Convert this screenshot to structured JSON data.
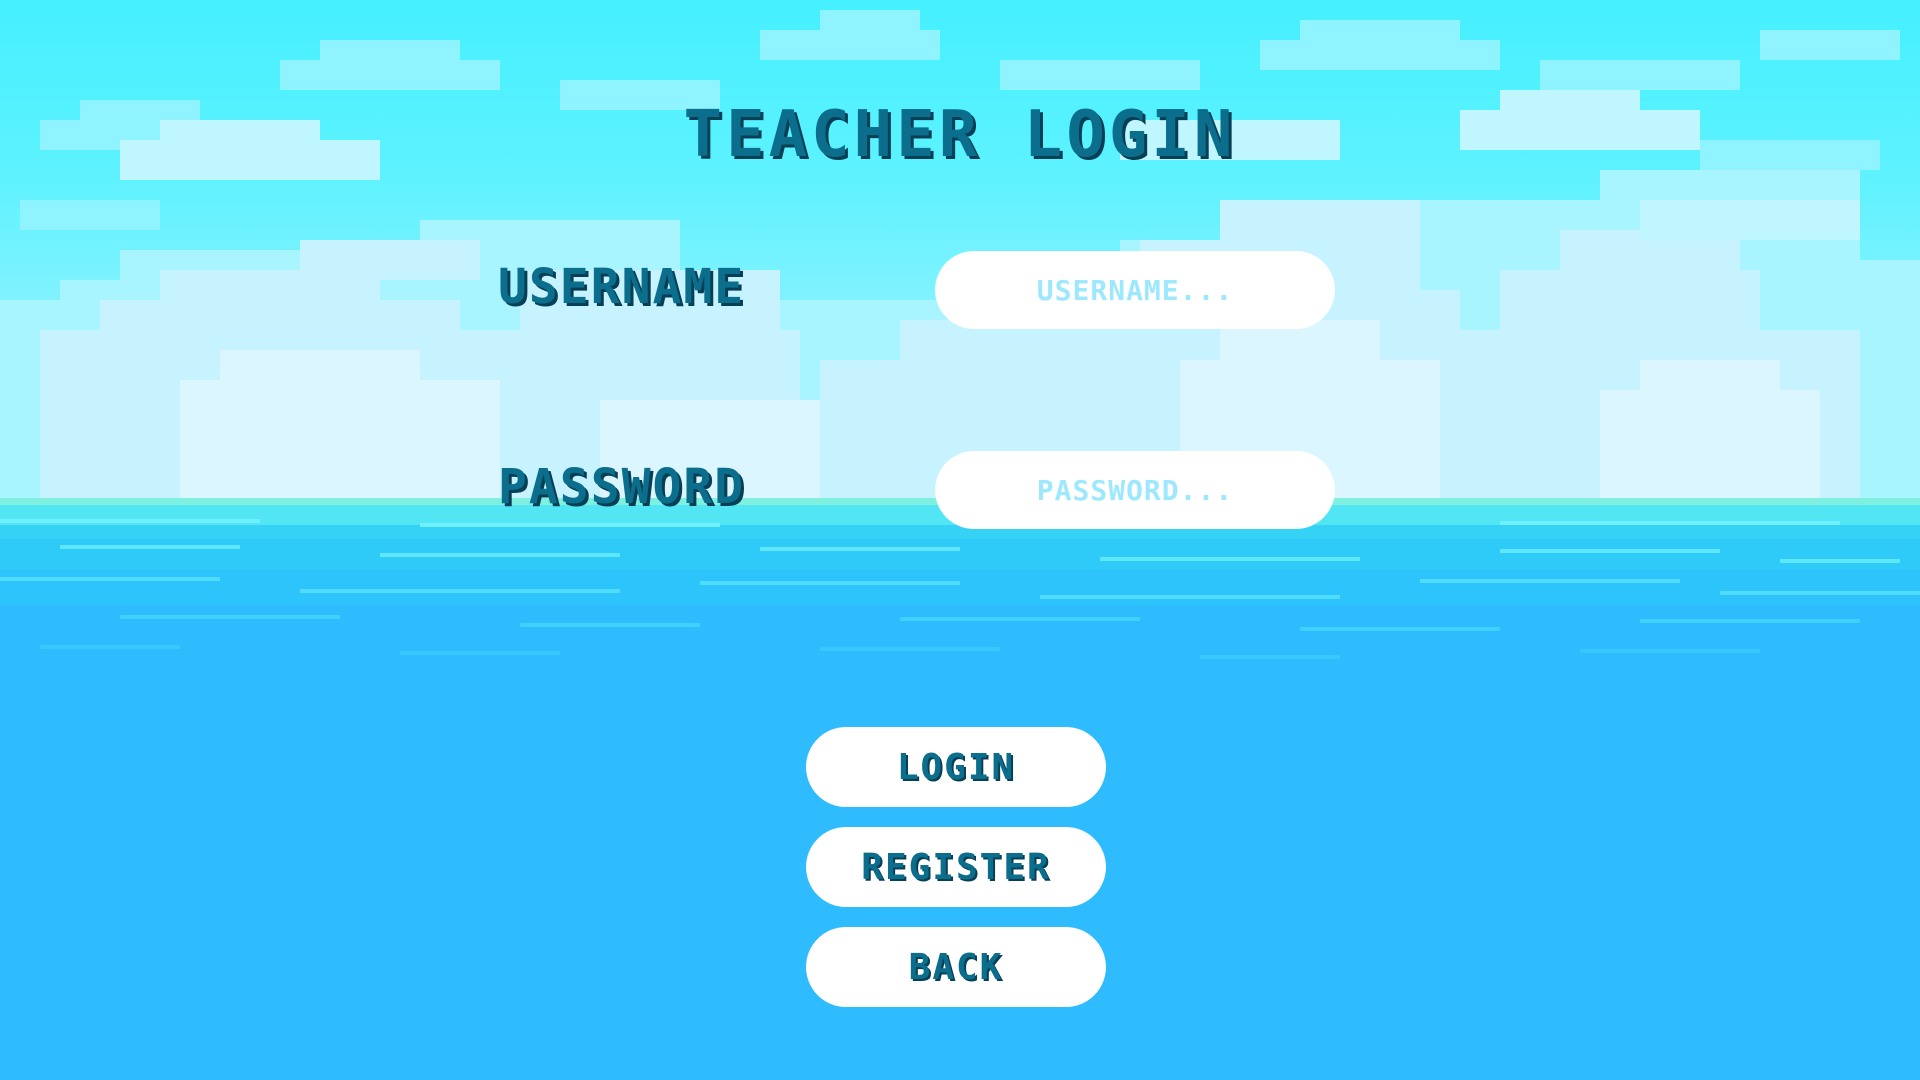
{
  "title": "TEACHER LOGIN",
  "form": {
    "username_label": "USERNAME",
    "username_placeholder": "USERNAME...",
    "password_label": "PASSWORD",
    "password_placeholder": "PASSWORD..."
  },
  "buttons": {
    "login": "LOGIN",
    "register": "REGISTER",
    "back": "BACK"
  },
  "colors": {
    "sky": "#45f0ff",
    "sea": "#2fbcff",
    "text": "#0b6e8c",
    "button_bg": "#ffffff",
    "placeholder": "#9ee8ff"
  }
}
